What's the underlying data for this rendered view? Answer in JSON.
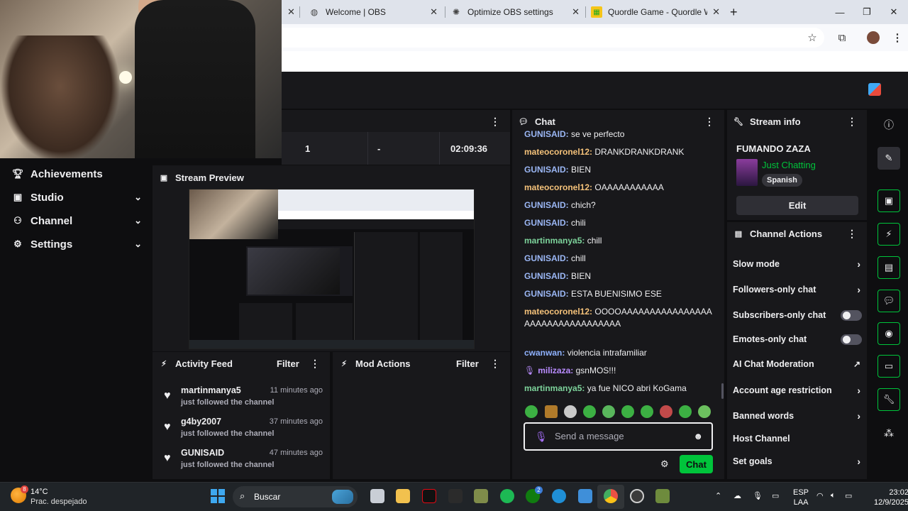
{
  "browser": {
    "tabs": [
      {
        "title": "Welcome | OBS",
        "icon": "globe-icon"
      },
      {
        "title": "Optimize OBS settings",
        "icon": "chatgpt-icon"
      },
      {
        "title": "Quordle Game - Quordle Word",
        "icon": "quordle-icon"
      }
    ],
    "new_tab": "+",
    "controls": {
      "minimize": "—",
      "maximize": "❐",
      "close": "✕"
    }
  },
  "leftnav": {
    "items": [
      {
        "label": "Achievements",
        "icon": "trophy-icon"
      },
      {
        "label": "Studio",
        "icon": "camera-icon"
      },
      {
        "label": "Channel",
        "icon": "people-icon"
      },
      {
        "label": "Settings",
        "icon": "gear-icon"
      }
    ]
  },
  "stats": {
    "viewers": "1",
    "followers": "-",
    "uptime": "02:09:36"
  },
  "preview": {
    "title": "Stream Preview"
  },
  "activity_feed": {
    "title": "Activity Feed",
    "filter": "Filter",
    "items": [
      {
        "name": "martinmanya5",
        "time": "11 minutes ago",
        "text": "just followed the channel"
      },
      {
        "name": "g4by2007",
        "time": "37 minutes ago",
        "text": "just followed the channel"
      },
      {
        "name": "GUNISAID",
        "time": "47 minutes ago",
        "text": "just followed the channel"
      }
    ]
  },
  "mod_actions": {
    "title": "Mod Actions",
    "filter": "Filter"
  },
  "chat": {
    "title": "Chat",
    "messages": [
      {
        "user": "GUNISAID",
        "text": "se ve perfecto",
        "color": "#9bb7f5"
      },
      {
        "user": "mateocoronel12",
        "text": "DRANKDRANKDRANK",
        "color": "#f5c27a"
      },
      {
        "user": "GUNISAID",
        "text": "BIEN",
        "color": "#9bb7f5"
      },
      {
        "user": "mateocoronel12",
        "text": "OAAAAAAAAAAA",
        "color": "#f5c27a"
      },
      {
        "user": "GUNISAID",
        "text": "chich?",
        "color": "#9bb7f5"
      },
      {
        "user": "GUNISAID",
        "text": "chili",
        "color": "#9bb7f5"
      },
      {
        "user": "martinmanya5",
        "text": "chill",
        "color": "#7dd39b"
      },
      {
        "user": "GUNISAID",
        "text": "chill",
        "color": "#9bb7f5"
      },
      {
        "user": "GUNISAID",
        "text": "BIEN",
        "color": "#9bb7f5"
      },
      {
        "user": "GUNISAID",
        "text": "ESTA BUENISIMO ESE",
        "color": "#9bb7f5"
      },
      {
        "user": "mateocoronel12",
        "text": "OOOOAAAAAAAAAAAAAAAAAAAAAAAAAAAAAAAAA",
        "color": "#f5c27a"
      },
      {
        "user": "cwanwan",
        "text": "violencia intrafamiliar",
        "color": "#8fb2ff"
      },
      {
        "user": "milizaza",
        "text": "gsnMOS!!!",
        "color": "#b98cff"
      },
      {
        "user": "martinmanya5",
        "text": "ya fue NICO abri KoGama",
        "color": "#7dd39b"
      }
    ],
    "placeholder": "Send a message",
    "send_label": "Chat"
  },
  "stream_info": {
    "title": "Stream info",
    "stream_title": "FUMANDO ZAZA",
    "category": "Just Chatting",
    "language": "Spanish",
    "edit_label": "Edit"
  },
  "channel_actions": {
    "title": "Channel Actions",
    "items": [
      {
        "label": "Slow mode",
        "kind": "arrow"
      },
      {
        "label": "Followers-only chat",
        "kind": "arrow"
      },
      {
        "label": "Subscribers-only chat",
        "kind": "toggle"
      },
      {
        "label": "Emotes-only chat",
        "kind": "toggle"
      },
      {
        "label": "AI Chat Moderation",
        "kind": "external"
      },
      {
        "label": "Account age restriction",
        "kind": "arrow"
      },
      {
        "label": "Banned words",
        "kind": "arrow"
      },
      {
        "label": "Host Channel",
        "kind": "none"
      },
      {
        "label": "Set goals",
        "kind": "arrow"
      }
    ]
  },
  "taskbar": {
    "weather_temp": "14°C",
    "weather_desc": "Prac. despejado",
    "weather_badge": "8",
    "search_label": "Buscar",
    "lang": "ESP",
    "layout": "LAA",
    "time": "23:02",
    "date": "12/9/2025",
    "xbox_badge": "2"
  },
  "colors": {
    "accent": "#00c43b",
    "bg": "#0e0e10",
    "panel": "#18181b"
  }
}
